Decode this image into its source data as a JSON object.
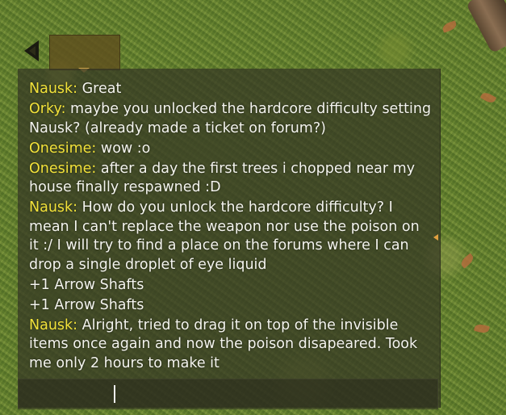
{
  "chat": {
    "messages": [
      {
        "name": "Nausk:",
        "text": " Great"
      },
      {
        "name": "Orky:",
        "text": " maybe you unlocked the hardcore difficulty setting Nausk? (already made a ticket on forum?)"
      },
      {
        "name": "Onesime:",
        "text": " wow :o"
      },
      {
        "name": "Onesime:",
        "text": " after a day the first trees i chopped near my house finally respawned :D"
      },
      {
        "name": "Nausk:",
        "text": " How do you unlock the hardcore difficulty? I mean I can't replace the weapon nor use the poison on it :/ I will try to find a place on the forums where I can drop a single droplet of eye liquid"
      },
      {
        "name": "",
        "text": "+1 Arrow Shafts"
      },
      {
        "name": "",
        "text": "+1 Arrow Shafts"
      },
      {
        "name": "Nausk:",
        "text": " Alright, tried to drag it on top of the invisible items once again and now the poison disapeared. Took me only 2 hours to make it"
      }
    ],
    "input": {
      "value": ""
    }
  },
  "icons": {
    "back": "back-arrow-icon",
    "tab_caret": "caret-down-icon",
    "scroll_marker": "scroll-marker-icon"
  },
  "colors": {
    "name": "#f2e23a",
    "text": "#f4f4ee",
    "panel": "#343624"
  }
}
